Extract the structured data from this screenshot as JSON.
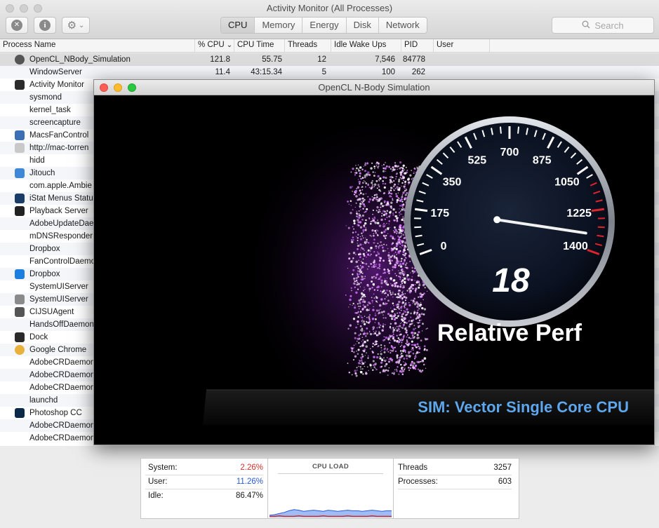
{
  "window": {
    "title": "Activity Monitor (All Processes)"
  },
  "toolbar": {
    "close_process_glyph": "✕",
    "info_glyph": "i",
    "gear_glyph": "⚙",
    "gear_menu_glyph": "⌄",
    "tabs": [
      "CPU",
      "Memory",
      "Energy",
      "Disk",
      "Network"
    ],
    "active_tab": "CPU",
    "search_placeholder": "Search"
  },
  "columns": [
    "Process Name",
    "% CPU",
    "CPU Time",
    "Threads",
    "Idle Wake Ups",
    "PID",
    "User"
  ],
  "sort_indicator": "⌄",
  "processes": [
    {
      "name": "OpenCL_NBody_Simulation",
      "cpu": "121.8",
      "cpu_time": "55.75",
      "threads": "12",
      "idle_wake_ups": "7,546",
      "pid": "84778",
      "icon": "nbody-sphere-icon",
      "color": "#555555"
    },
    {
      "name": "WindowServer",
      "cpu": "11.4",
      "cpu_time": "43:15.34",
      "threads": "5",
      "idle_wake_ups": "100",
      "pid": "262",
      "icon": "",
      "color": ""
    },
    {
      "name": "Activity Monitor",
      "icon": "activity-monitor-icon",
      "color": "#2b2b2b"
    },
    {
      "name": "sysmond",
      "icon": "",
      "color": ""
    },
    {
      "name": "kernel_task",
      "icon": "",
      "color": ""
    },
    {
      "name": "screencapture",
      "icon": "",
      "color": ""
    },
    {
      "name": "MacsFanControl",
      "icon": "fan-icon",
      "color": "#3d6fb5"
    },
    {
      "name": "http://mac-torren",
      "icon": "shield-icon",
      "color": "#c9c9c9"
    },
    {
      "name": "hidd",
      "icon": "",
      "color": ""
    },
    {
      "name": "Jitouch",
      "icon": "jitouch-icon",
      "color": "#3f88d8"
    },
    {
      "name": "com.apple.Ambie",
      "icon": "",
      "color": ""
    },
    {
      "name": "iStat Menus Statu",
      "icon": "istat-icon",
      "color": "#1b3c66"
    },
    {
      "name": "Playback Server",
      "icon": "playback-icon",
      "color": "#222222"
    },
    {
      "name": "AdobeUpdateDae",
      "icon": "",
      "color": ""
    },
    {
      "name": "mDNSResponder",
      "icon": "",
      "color": ""
    },
    {
      "name": "Dropbox",
      "icon": "",
      "color": ""
    },
    {
      "name": "FanControlDaemo",
      "icon": "",
      "color": ""
    },
    {
      "name": "Dropbox",
      "icon": "dropbox-icon",
      "color": "#1a7fe0"
    },
    {
      "name": "SystemUIServer",
      "icon": "",
      "color": ""
    },
    {
      "name": "SystemUIServer",
      "icon": "systemuiserver-icon",
      "color": "#8a8a8a"
    },
    {
      "name": "CIJSUAgent",
      "icon": "cijsuagent-icon",
      "color": "#555555"
    },
    {
      "name": "HandsOffDaemon",
      "icon": "",
      "color": ""
    },
    {
      "name": "Dock",
      "icon": "dock-icon",
      "color": "#2a2a2a"
    },
    {
      "name": "Google Chrome",
      "icon": "chrome-icon",
      "color": "#e8b13a"
    },
    {
      "name": "AdobeCRDaemon",
      "icon": "",
      "color": ""
    },
    {
      "name": "AdobeCRDaemon",
      "icon": "",
      "color": ""
    },
    {
      "name": "AdobeCRDaemon",
      "icon": "",
      "color": ""
    },
    {
      "name": "launchd",
      "icon": "",
      "color": ""
    },
    {
      "name": "Photoshop CC",
      "icon": "photoshop-icon",
      "color": "#0b2a4a"
    },
    {
      "name": "AdobeCRDaemon",
      "icon": "",
      "color": ""
    },
    {
      "name": "AdobeCRDaemon",
      "icon": "",
      "color": ""
    }
  ],
  "nbody": {
    "title": "OpenCL N-Body Simulation",
    "gauge_ticks": [
      "0",
      "175",
      "350",
      "525",
      "700",
      "875",
      "1050",
      "1225",
      "1400"
    ],
    "gauge_value": "18",
    "gauge_label": "Relative Perf",
    "sim_label": "SIM: Vector Single Core CPU"
  },
  "stats": {
    "system_label": "System:",
    "system_value": "2.26%",
    "user_label": "User:",
    "user_value": "11.26%",
    "idle_label": "Idle:",
    "idle_value": "86.47%",
    "cpu_load_label": "CPU LOAD",
    "threads_label": "Threads",
    "threads_value": "3257",
    "processes_label": "Processes:",
    "processes_value": "603",
    "system_color": "#d0312d",
    "user_color": "#2a5bd7",
    "system_load_series": [
      2,
      2,
      3,
      2,
      2,
      2,
      3,
      2,
      2,
      2,
      2,
      3,
      2,
      2,
      2,
      2,
      3,
      2,
      2,
      2,
      2,
      3,
      2,
      2,
      2,
      2
    ],
    "user_load_series": [
      4,
      5,
      7,
      9,
      12,
      14,
      13,
      11,
      12,
      13,
      12,
      11,
      13,
      12,
      11,
      12,
      13,
      12,
      12,
      11,
      12,
      13,
      12,
      11,
      12,
      12
    ]
  }
}
